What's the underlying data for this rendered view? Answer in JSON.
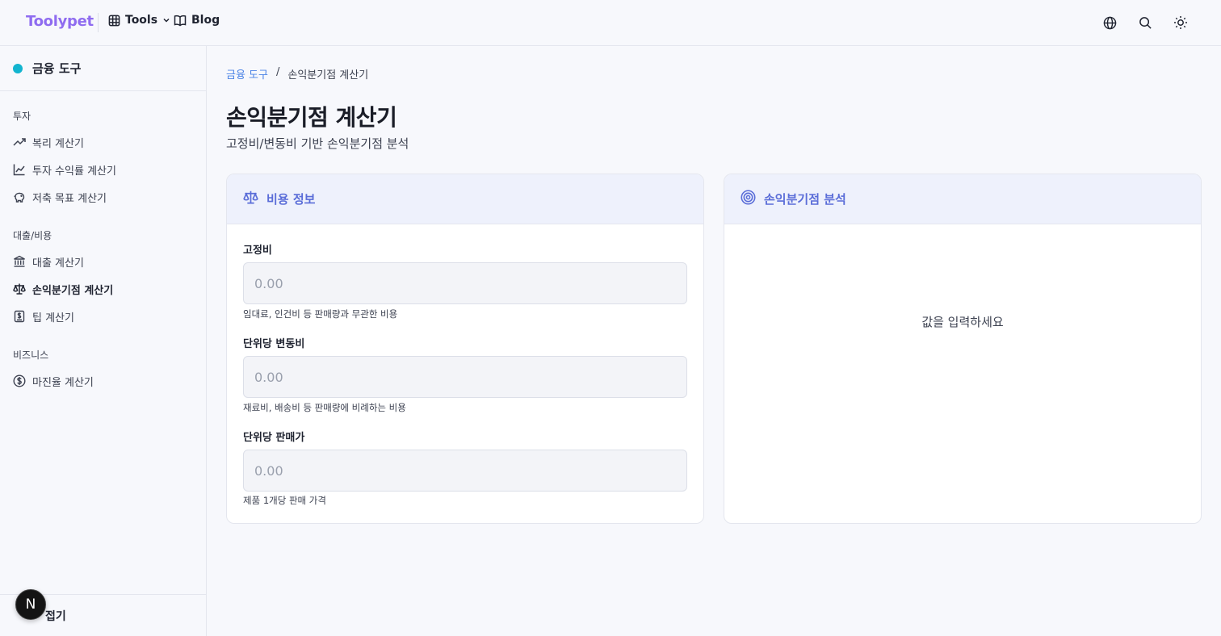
{
  "header": {
    "logo": "Toolypet",
    "nav": [
      {
        "label": "Tools",
        "icon": "grid-icon"
      },
      {
        "label": "Blog",
        "icon": "book-icon"
      }
    ],
    "actions": [
      "globe-icon",
      "search-icon",
      "sun-icon"
    ]
  },
  "sidebar": {
    "title": "금융 도구",
    "accent": "#12b4cf",
    "groups": [
      {
        "label": "투자",
        "items": [
          {
            "label": "복리 계산기",
            "icon": "trending-up-icon"
          },
          {
            "label": "투자 수익률 계산기",
            "icon": "line-chart-icon"
          },
          {
            "label": "저축 목표 계산기",
            "icon": "piggy-bank-icon"
          }
        ]
      },
      {
        "label": "대출/비용",
        "items": [
          {
            "label": "대출 계산기",
            "icon": "bank-icon"
          },
          {
            "label": "손익분기점 계산기",
            "icon": "scale-icon",
            "active": true
          },
          {
            "label": "팁 계산기",
            "icon": "receipt-icon"
          }
        ]
      },
      {
        "label": "비즈니스",
        "items": [
          {
            "label": "마진율 계산기",
            "icon": "dollar-circle-icon"
          }
        ]
      }
    ],
    "footer_label": "접기",
    "badge": "N"
  },
  "breadcrumb": {
    "parent": "금융 도구",
    "separator": "/",
    "current": "손익분기점 계산기"
  },
  "page": {
    "title": "손익분기점 계산기",
    "subtitle": "고정비/변동비 기반 손익분기점 분석"
  },
  "cost_card": {
    "title": "비용 정보",
    "fields": [
      {
        "label": "고정비",
        "placeholder": "0.00",
        "value": "",
        "help": "임대료, 인건비 등 판매량과 무관한 비용"
      },
      {
        "label": "단위당 변동비",
        "placeholder": "0.00",
        "value": "",
        "help": "재료비, 배송비 등 판매량에 비례하는 비용"
      },
      {
        "label": "단위당 판매가",
        "placeholder": "0.00",
        "value": "",
        "help": "제품 1개당 판매 가격"
      }
    ]
  },
  "analysis_card": {
    "title": "손익분기점 분석",
    "empty_message": "값을 입력하세요"
  },
  "colors": {
    "brand": "#8f6cf0",
    "link": "#4b83e6",
    "card_header_text": "#5a6dd8",
    "card_header_bg": "#eef1fc"
  }
}
